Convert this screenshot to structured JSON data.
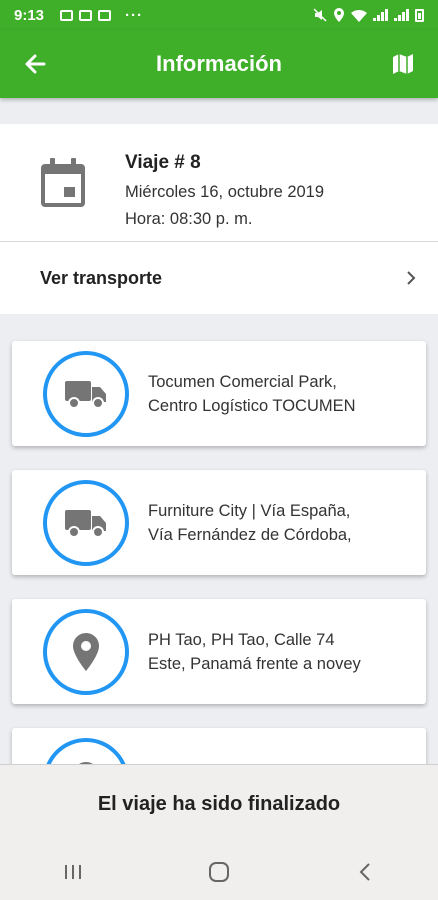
{
  "status_bar": {
    "time": "9:13",
    "overflow": "···"
  },
  "app_bar": {
    "title": "Información",
    "back_icon": "arrow-left-icon",
    "map_icon": "map-icon"
  },
  "trip": {
    "title": "Viaje # 8",
    "date": "Miércoles 16, octubre 2019",
    "time": "Hora: 08:30 p. m.",
    "ver_transporte": "Ver transporte"
  },
  "stops": [
    {
      "icon": "truck-icon",
      "line1": "Tocumen Comercial Park,",
      "line2": "Centro Logístico TOCUMEN"
    },
    {
      "icon": "truck-icon",
      "line1": "Furniture City | Vía España,",
      "line2": "Vía Fernández de Córdoba,"
    },
    {
      "icon": "location-pin-icon",
      "line1": "PH Tao, PH Tao, Calle 74",
      "line2": "Este, Panamá frente a novey"
    },
    {
      "icon": "location-pin-icon",
      "line1": "",
      "line2": ""
    }
  ],
  "footer": {
    "message": "El viaje ha sido finalizado"
  },
  "colors": {
    "primary": "#3fae29",
    "accent": "#2196f3",
    "icon_gray": "#757575"
  }
}
